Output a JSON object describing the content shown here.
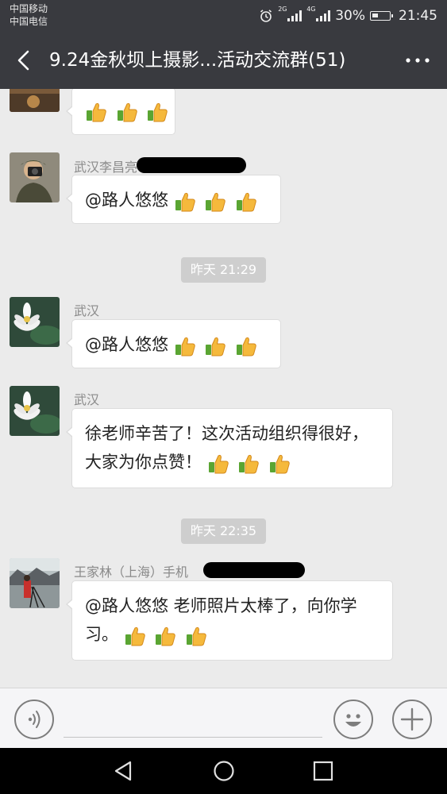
{
  "status_bar": {
    "carrier_1": "中国移动",
    "carrier_2": "中国电信",
    "network_1": "2G",
    "network_2": "4G",
    "battery": "30%",
    "time": "21:45"
  },
  "header": {
    "title": "9.24金秋坝上摄影...活动交流群(51)",
    "back_icon": "chevron-left-icon",
    "more_icon": "more-dots-icon"
  },
  "messages": [
    {
      "sender": "",
      "text": "",
      "thumbs": 3
    },
    {
      "sender": "武汉李昌亮",
      "text": "@路人悠悠 ",
      "thumbs": 3
    },
    {
      "sender": "武汉",
      "text": "@路人悠悠 ",
      "thumbs": 3
    },
    {
      "sender": "武汉",
      "text": "徐老师辛苦了！这次活动组织得很好，大家为你点赞！",
      "thumbs": 3
    },
    {
      "sender": "王家林（上海）手机",
      "text": "@路人悠悠  老师照片太棒了，向你学习。",
      "thumbs": 3
    }
  ],
  "timestamps": [
    "昨天 21:29",
    "昨天 22:35"
  ],
  "input_bar": {
    "voice_icon": "voice-icon",
    "emoji_icon": "emoji-icon",
    "plus_icon": "plus-icon"
  },
  "colors": {
    "header_bg": "#393a3f",
    "chat_bg": "#ebebeb",
    "bubble_bg": "#ffffff",
    "timestamp_bg": "#cecece"
  }
}
